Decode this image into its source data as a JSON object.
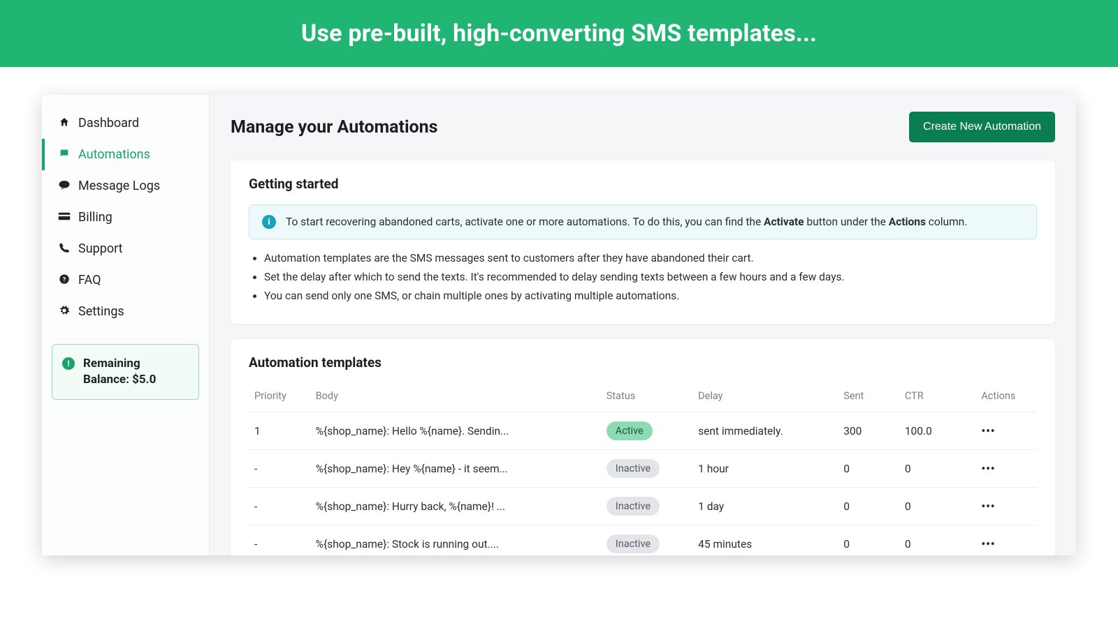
{
  "banner": "Use pre-built, high-converting SMS templates...",
  "sidebar": {
    "items": [
      {
        "label": "Dashboard",
        "icon": "home"
      },
      {
        "label": "Automations",
        "icon": "chat",
        "active": true
      },
      {
        "label": "Message Logs",
        "icon": "sms"
      },
      {
        "label": "Billing",
        "icon": "card"
      },
      {
        "label": "Support",
        "icon": "phone"
      },
      {
        "label": "FAQ",
        "icon": "question"
      },
      {
        "label": "Settings",
        "icon": "gear"
      }
    ],
    "balance_label": "Remaining Balance: $5.0"
  },
  "main": {
    "title": "Manage your Automations",
    "create_button": "Create New Automation",
    "getting_started": {
      "title": "Getting started",
      "alert_prefix": "To start recovering abandoned carts, activate one or more automations. To do this, you can find the ",
      "alert_bold1": "Activate",
      "alert_mid": " button under the ",
      "alert_bold2": "Actions",
      "alert_suffix": " column.",
      "bullets": [
        "Automation templates are the SMS messages sent to customers after they have abandoned their cart.",
        "Set the delay after which to send the texts. It's recommended to delay sending texts between a few hours and a few days.",
        "You can send only one SMS, or chain multiple ones by activating multiple automations."
      ]
    },
    "templates": {
      "title": "Automation templates",
      "columns": {
        "priority": "Priority",
        "body": "Body",
        "status": "Status",
        "delay": "Delay",
        "sent": "Sent",
        "ctr": "CTR",
        "actions": "Actions"
      },
      "rows": [
        {
          "priority": "1",
          "body": "%{shop_name}: Hello %{name}. Sendin...",
          "status": "Active",
          "delay": "sent immediately.",
          "sent": "300",
          "ctr": "100.0"
        },
        {
          "priority": "-",
          "body": "%{shop_name}: Hey %{name} - it seem...",
          "status": "Inactive",
          "delay": "1 hour",
          "sent": "0",
          "ctr": "0"
        },
        {
          "priority": "-",
          "body": "%{shop_name}: Hurry back, %{name}! ...",
          "status": "Inactive",
          "delay": "1 day",
          "sent": "0",
          "ctr": "0"
        },
        {
          "priority": "-",
          "body": "%{shop_name}: Stock is running out....",
          "status": "Inactive",
          "delay": "45 minutes",
          "sent": "0",
          "ctr": "0"
        }
      ]
    }
  }
}
